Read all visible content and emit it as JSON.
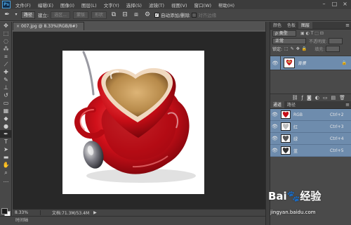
{
  "app": {
    "logo": "Ps"
  },
  "menubar": {
    "items": [
      "文件(F)",
      "编辑(E)",
      "图像(I)",
      "图层(L)",
      "文字(Y)",
      "选择(S)",
      "滤镜(T)",
      "视图(V)",
      "窗口(W)",
      "帮助(H)"
    ],
    "window_controls": [
      "–",
      "□",
      "×"
    ]
  },
  "options_bar": {
    "tool_icon": "pen-icon",
    "mode_select": "路径",
    "make_label": "建立:",
    "selection_button": "选区...",
    "mask_button": "蒙版",
    "shape_button": "形状",
    "auto_add_delete_label": "自动添加/删除",
    "align_edges_label": "对齐边缘"
  },
  "document": {
    "tab_title": "007.jpg @ 8.33%(RGB/8#)",
    "tab_close": "×",
    "zoom": "8.33%",
    "doc_info": "文档:71.3M/53.4M",
    "status_arrow": "▶"
  },
  "timeline": {
    "label": "时间轴"
  },
  "layers_panel": {
    "tabs": [
      {
        "label": "颜色",
        "active": false
      },
      {
        "label": "色板",
        "active": false
      },
      {
        "label": "图层",
        "active": true
      }
    ],
    "kind_label": "ρ 类型",
    "blend_mode": "正常",
    "opacity_label": "不透明度:",
    "lock_label": "锁定:",
    "fill_label": "填充:",
    "layer": {
      "name": "背景",
      "lock_icon": "🔒"
    }
  },
  "channels_panel": {
    "tabs": [
      {
        "label": "通道",
        "active": true
      },
      {
        "label": "路径",
        "active": false
      }
    ],
    "channels": [
      {
        "name": "RGB",
        "shortcut": "Ctrl+2",
        "thumb": "color"
      },
      {
        "name": "红",
        "shortcut": "Ctrl+3",
        "thumb": "gray"
      },
      {
        "name": "绿",
        "shortcut": "Ctrl+4",
        "thumb": "gray"
      },
      {
        "name": "蓝",
        "shortcut": "Ctrl+5",
        "thumb": "dark"
      }
    ]
  },
  "watermark": {
    "logo": "Bai🐾经验",
    "url": "jingyan.baidu.com"
  },
  "colors": {
    "heart_red": "#d0101a",
    "coffee": "#c49a5a",
    "selected_row": "#6e8cad"
  }
}
